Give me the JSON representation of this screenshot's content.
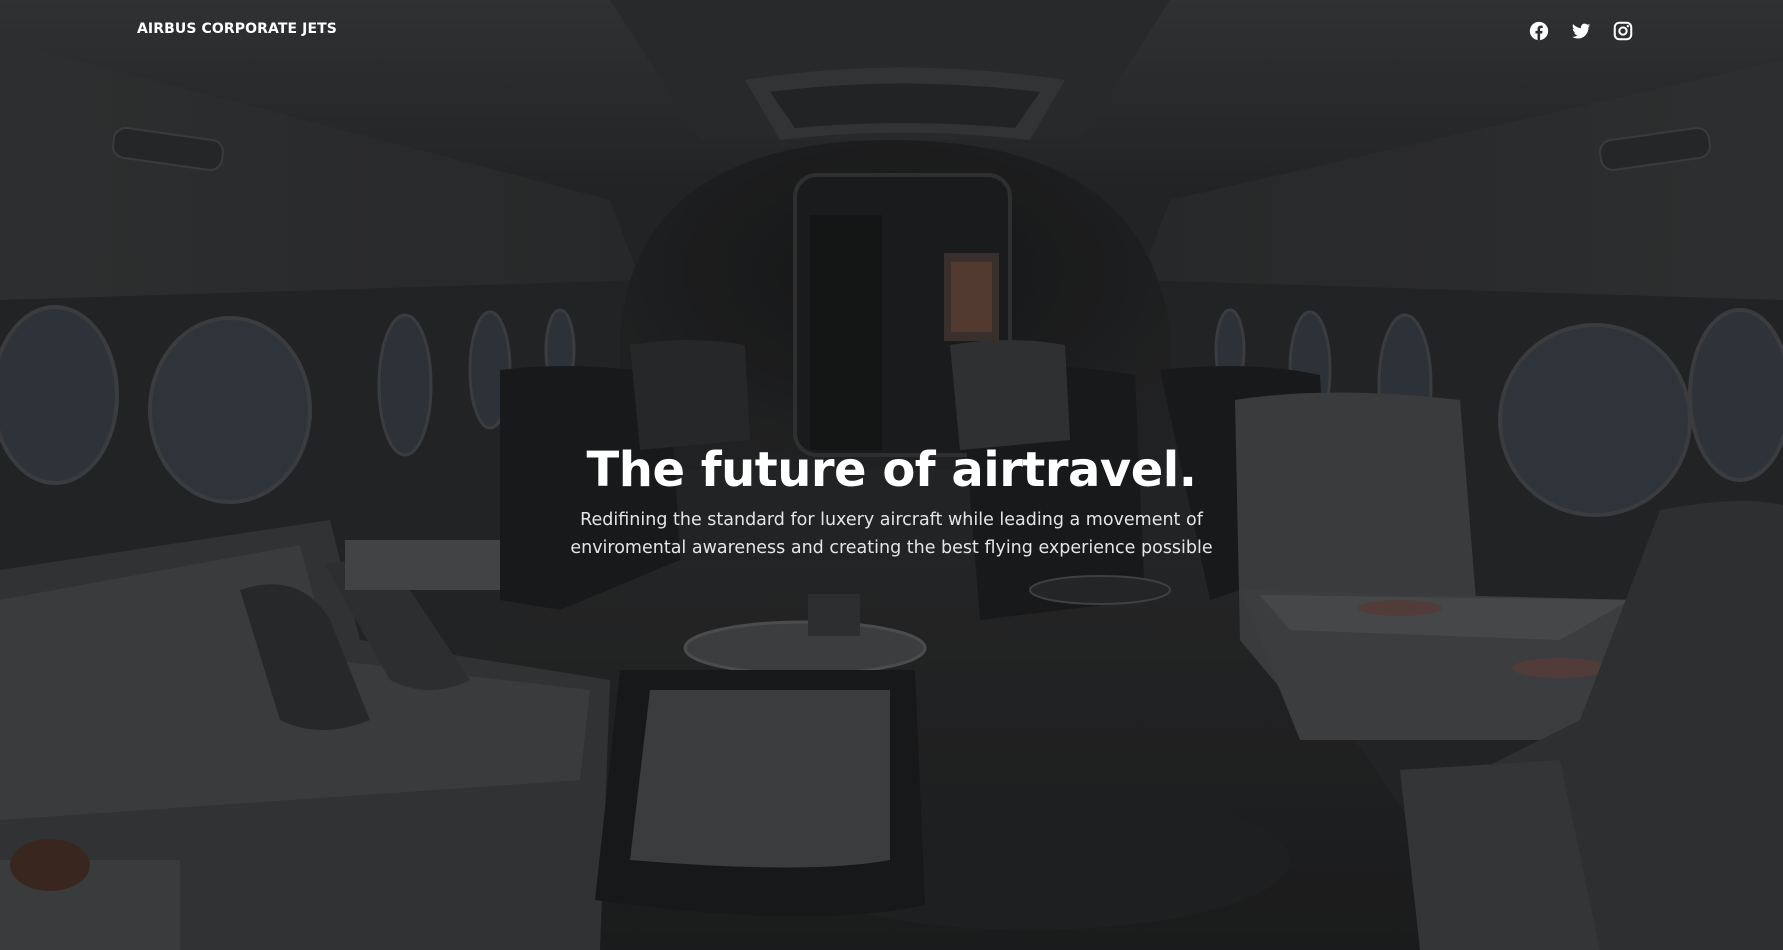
{
  "header": {
    "brand": "AIRBUS CORPORATE JETS",
    "social": [
      {
        "name": "facebook",
        "icon": "facebook-icon"
      },
      {
        "name": "twitter",
        "icon": "twitter-icon"
      },
      {
        "name": "instagram",
        "icon": "instagram-icon"
      }
    ]
  },
  "hero": {
    "title": "The future of airtravel.",
    "subtitle": "Redifining the standard for luxery aircraft while leading a movement of enviromental awareness and creating the best flying experience possible"
  },
  "colors": {
    "text": "#ffffff",
    "subtitle": "#e3e5e8",
    "overlay": "#242628"
  }
}
